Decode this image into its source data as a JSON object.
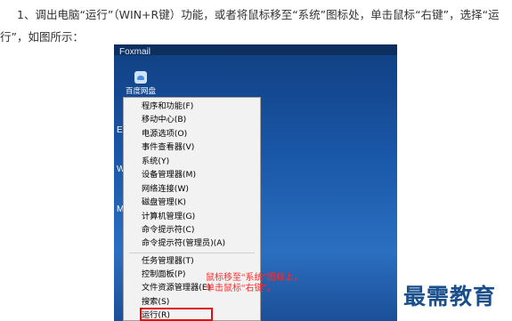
{
  "intro": {
    "line1": "1、调出电脑“运行”（WIN+R键）功能，或者将鼠标移至“系统”图标处，单击鼠标“右键”，选择“运",
    "line2": "行”，如图所示："
  },
  "screenshot": {
    "app_title": "Foxmail",
    "desktop_icon_label": "百度网盘",
    "edge_letters": [
      "E",
      "W",
      "M"
    ],
    "menu": {
      "group1": [
        "程序和功能(F)",
        "移动中心(B)",
        "电源选项(O)",
        "事件查看器(V)",
        "系统(Y)",
        "设备管理器(M)",
        "网络连接(W)",
        "磁盘管理(K)",
        "计算机管理(G)",
        "命令提示符(C)",
        "命令提示符(管理员)(A)"
      ],
      "group2": [
        "任务管理器(T)",
        "控制面板(P)",
        "文件资源管理器(E)",
        "搜索(S)"
      ],
      "run": "运行(R)"
    },
    "annotation": [
      "鼠标移至“系统”图标上，",
      "单击鼠标“右键”。"
    ],
    "colors": {
      "highlight": "#e01010",
      "annotation": "#ff2a2a"
    }
  },
  "watermark": "最需教育"
}
